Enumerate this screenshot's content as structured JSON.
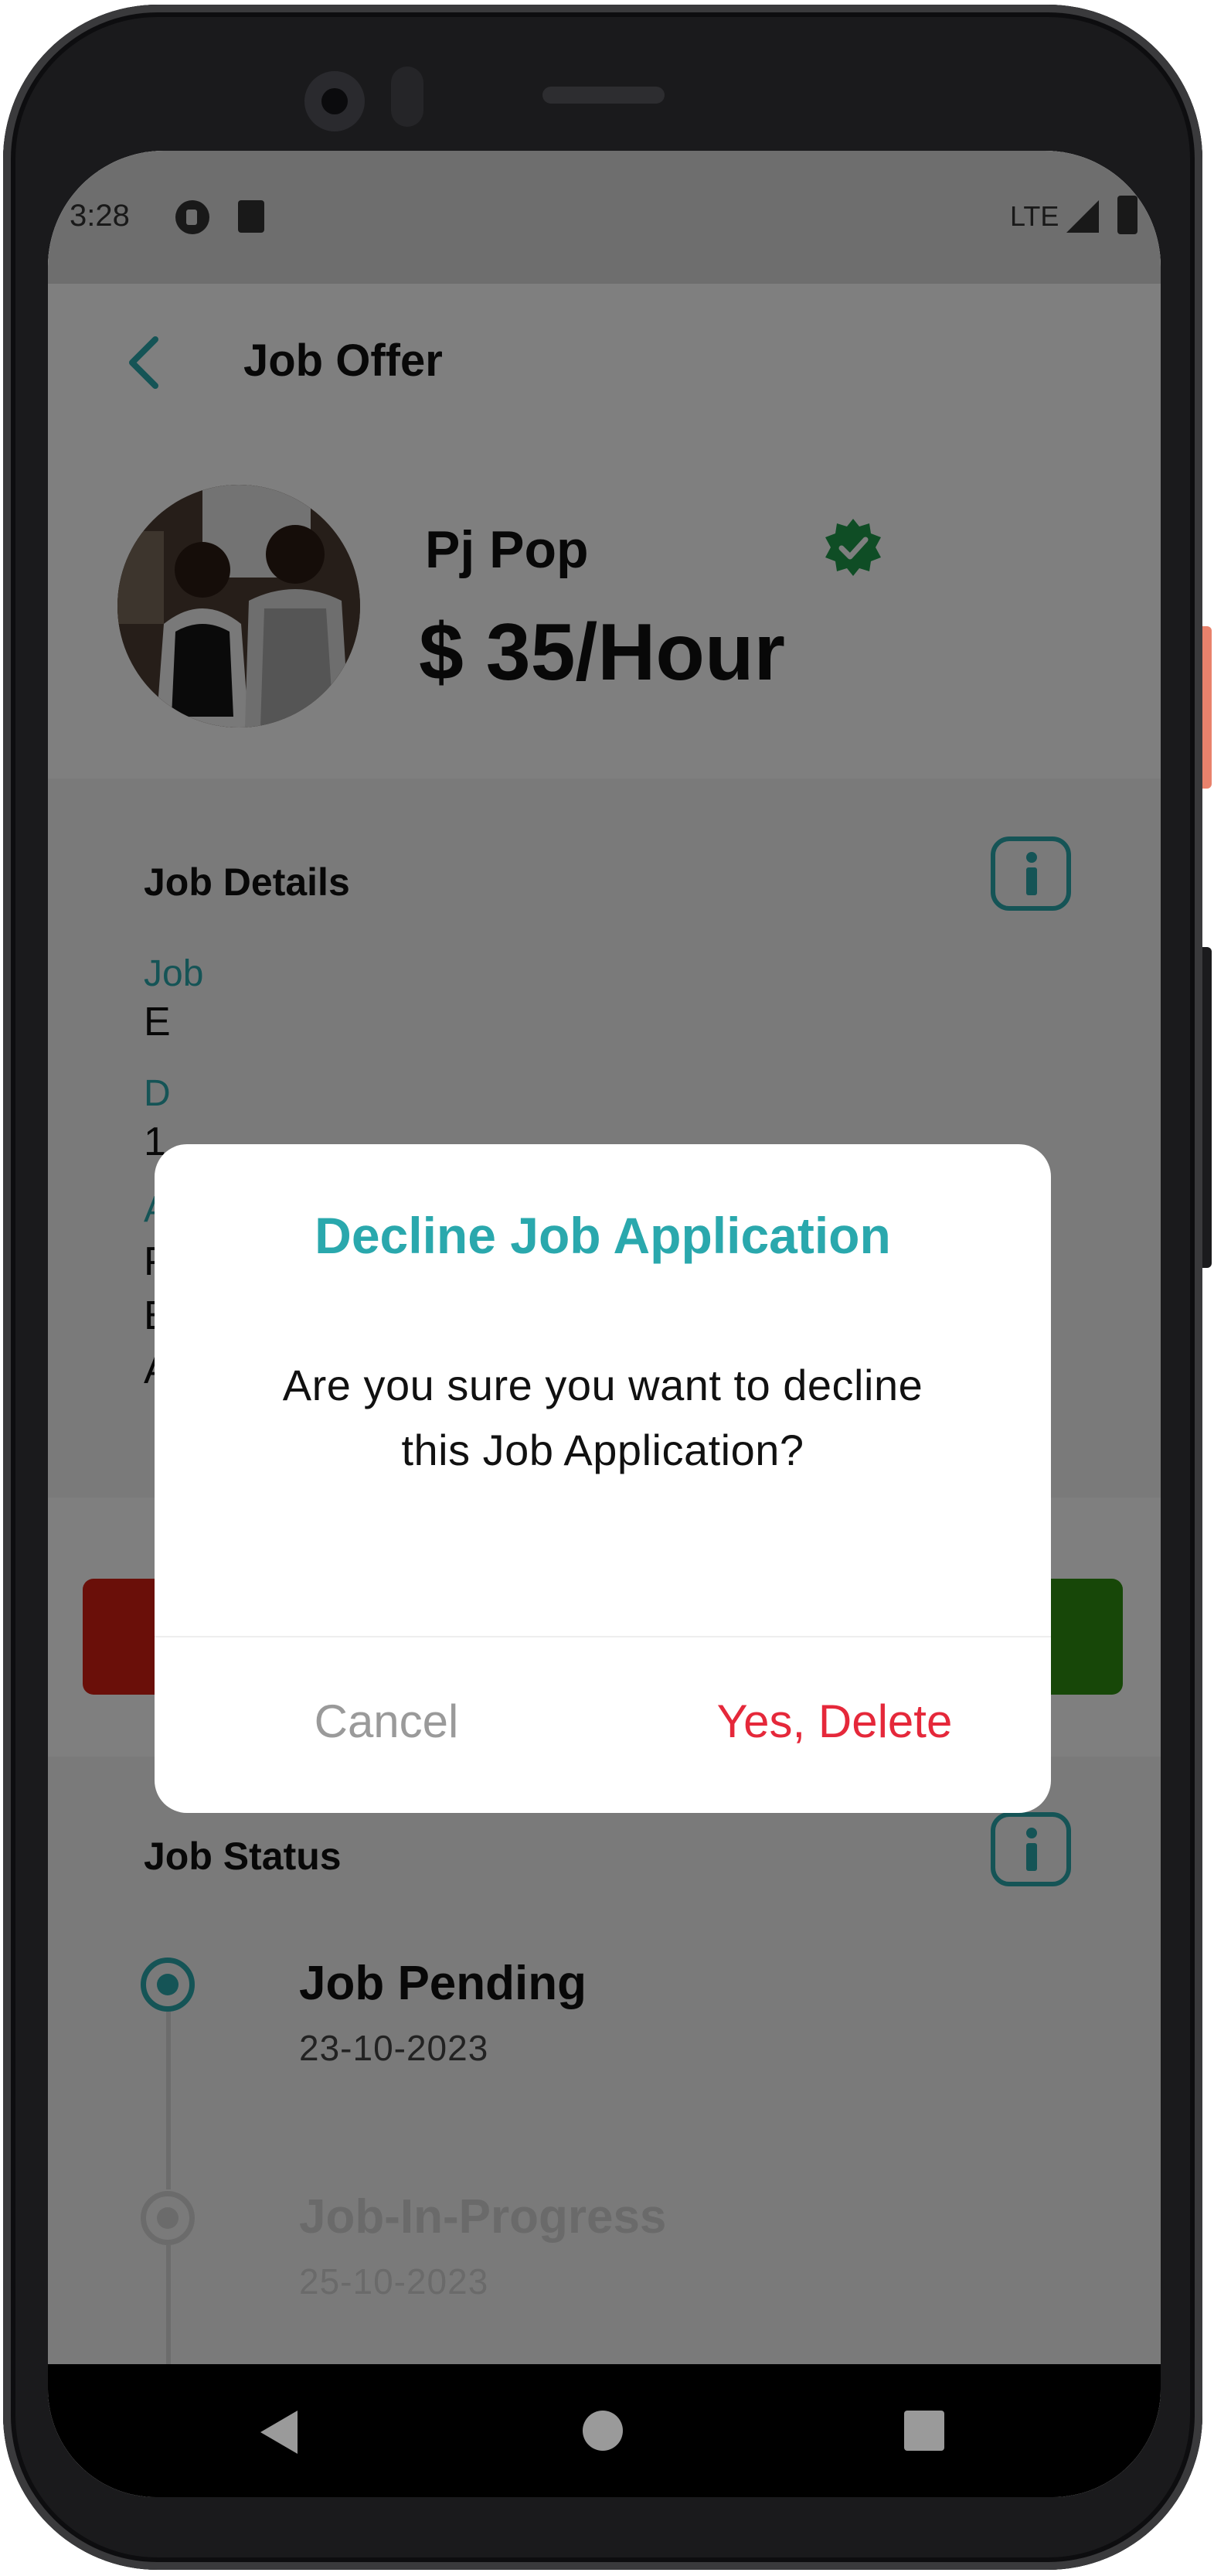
{
  "status_bar": {
    "time": "3:28",
    "network": "LTE"
  },
  "header": {
    "title": "Job Offer"
  },
  "profile": {
    "name": "Pj Pop",
    "rate": "$ 35/Hour"
  },
  "job_details": {
    "title": "Job Details",
    "job_label": "Job",
    "job_value_partial": "E",
    "date_label_partial": "D",
    "date_value_partial": "1",
    "address_label_partial": "A",
    "address_lines_partial": [
      "P",
      "E",
      "A"
    ]
  },
  "job_status": {
    "title": "Job Status",
    "steps": [
      {
        "label": "Job Pending",
        "date": "23-10-2023"
      },
      {
        "label": "Job-In-Progress",
        "date": "25-10-2023"
      }
    ]
  },
  "dialog": {
    "title": "Decline Job Application",
    "message_line1": "Are you sure you want to decline",
    "message_line2": "this Job Application?",
    "cancel_label": "Cancel",
    "confirm_label": "Yes, Delete"
  },
  "colors": {
    "accent": "#2aa8ad",
    "danger": "#e5283a",
    "decline_button": "#d41e12",
    "accept_button": "#2e8f10",
    "verified": "#1f9a4b"
  },
  "icons": [
    "back-arrow-icon",
    "verified-badge-icon",
    "info-icon",
    "timeline-dot-icon",
    "nav-back-icon",
    "nav-home-icon",
    "nav-recents-icon"
  ]
}
